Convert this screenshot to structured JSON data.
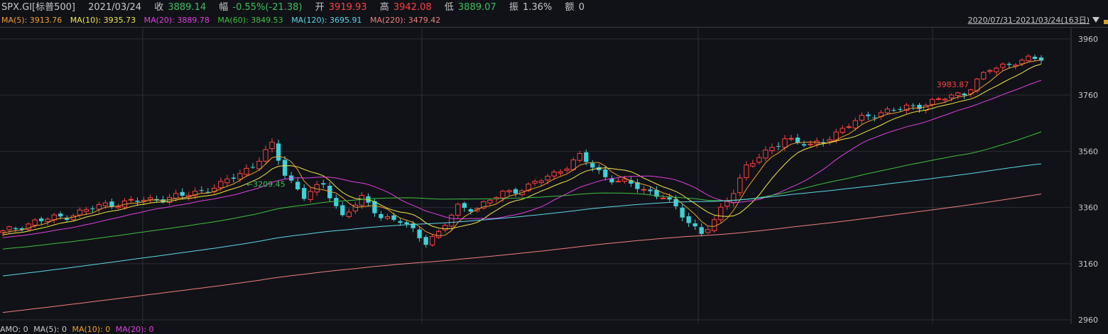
{
  "header": {
    "symbol": "SPX.GI[标普500]",
    "date": "2021/03/24",
    "close_label": "收",
    "close": "3889.14",
    "chg_label": "幅",
    "chg": "-0.55%(-21.38)",
    "open_label": "开",
    "open": "3919.93",
    "high_label": "高",
    "high": "3942.08",
    "low_label": "低",
    "low": "3889.07",
    "amp_label": "振",
    "amp": "1.36%",
    "amt_label": "额",
    "amt": "0"
  },
  "ma_legend": [
    {
      "text": "MA(5): 3913.76",
      "color": "#f0a030"
    },
    {
      "text": "MA(10): 3935.73",
      "color": "#f5e84a"
    },
    {
      "text": "MA(20): 3889.78",
      "color": "#e040e0"
    },
    {
      "text": "MA(60): 3849.53",
      "color": "#40c040"
    },
    {
      "text": "MA(120): 3695.91",
      "color": "#5ed8e8"
    },
    {
      "text": "MA(220): 3479.42",
      "color": "#f08080"
    }
  ],
  "range_label": "2020/07/31-2021/03/24(163日)",
  "amo_legend": [
    {
      "text": "AMO: 0",
      "color": "#c8c8c8"
    },
    {
      "text": "MA(5): 0",
      "color": "#c8c8c8"
    },
    {
      "text": "MA(10): 0",
      "color": "#f0a030"
    },
    {
      "text": "MA(20): 0",
      "color": "#e040e0"
    }
  ],
  "colors": {
    "up": "#ff4040",
    "down": "#3fd0d8",
    "grid": "#2a2d33",
    "bg": "#101217"
  },
  "chart_data": {
    "type": "candlestick",
    "y_ticks": [
      2960,
      3160,
      3360,
      3560,
      3760,
      3960
    ],
    "ylim": [
      2945,
      4000
    ],
    "count": 163,
    "first_close": 3271,
    "closes_anchor": [
      [
        0,
        3271
      ],
      [
        5,
        3310
      ],
      [
        10,
        3330
      ],
      [
        16,
        3370
      ],
      [
        22,
        3385
      ],
      [
        28,
        3400
      ],
      [
        34,
        3440
      ],
      [
        39,
        3510
      ],
      [
        42,
        3580
      ],
      [
        44,
        3480
      ],
      [
        47,
        3400
      ],
      [
        50,
        3440
      ],
      [
        53,
        3330
      ],
      [
        56,
        3390
      ],
      [
        59,
        3330
      ],
      [
        62,
        3310
      ],
      [
        66,
        3240
      ],
      [
        68,
        3270
      ],
      [
        71,
        3360
      ],
      [
        74,
        3360
      ],
      [
        78,
        3410
      ],
      [
        82,
        3435
      ],
      [
        86,
        3480
      ],
      [
        90,
        3540
      ],
      [
        94,
        3470
      ],
      [
        98,
        3440
      ],
      [
        103,
        3400
      ],
      [
        106,
        3330
      ],
      [
        109,
        3270
      ],
      [
        111,
        3310
      ],
      [
        114,
        3420
      ],
      [
        116,
        3510
      ],
      [
        119,
        3550
      ],
      [
        122,
        3610
      ],
      [
        126,
        3575
      ],
      [
        130,
        3625
      ],
      [
        135,
        3690
      ],
      [
        140,
        3710
      ],
      [
        145,
        3735
      ],
      [
        150,
        3770
      ],
      [
        154,
        3850
      ],
      [
        158,
        3880
      ],
      [
        162,
        3889
      ]
    ],
    "annotations": [
      {
        "text": "3983.87",
        "color": "#ff4040",
        "index": 151
      },
      {
        "text": "3209.45",
        "color": "#3fbf5f",
        "index": 38
      }
    ],
    "ma_series": [
      {
        "period": 5,
        "color": "#f0a030"
      },
      {
        "period": 10,
        "color": "#f5e84a"
      },
      {
        "period": 20,
        "color": "#e040e0"
      },
      {
        "period": 60,
        "color": "#40c040"
      },
      {
        "period": 120,
        "color": "#5ed8e8"
      },
      {
        "period": 220,
        "color": "#f08080"
      }
    ]
  }
}
